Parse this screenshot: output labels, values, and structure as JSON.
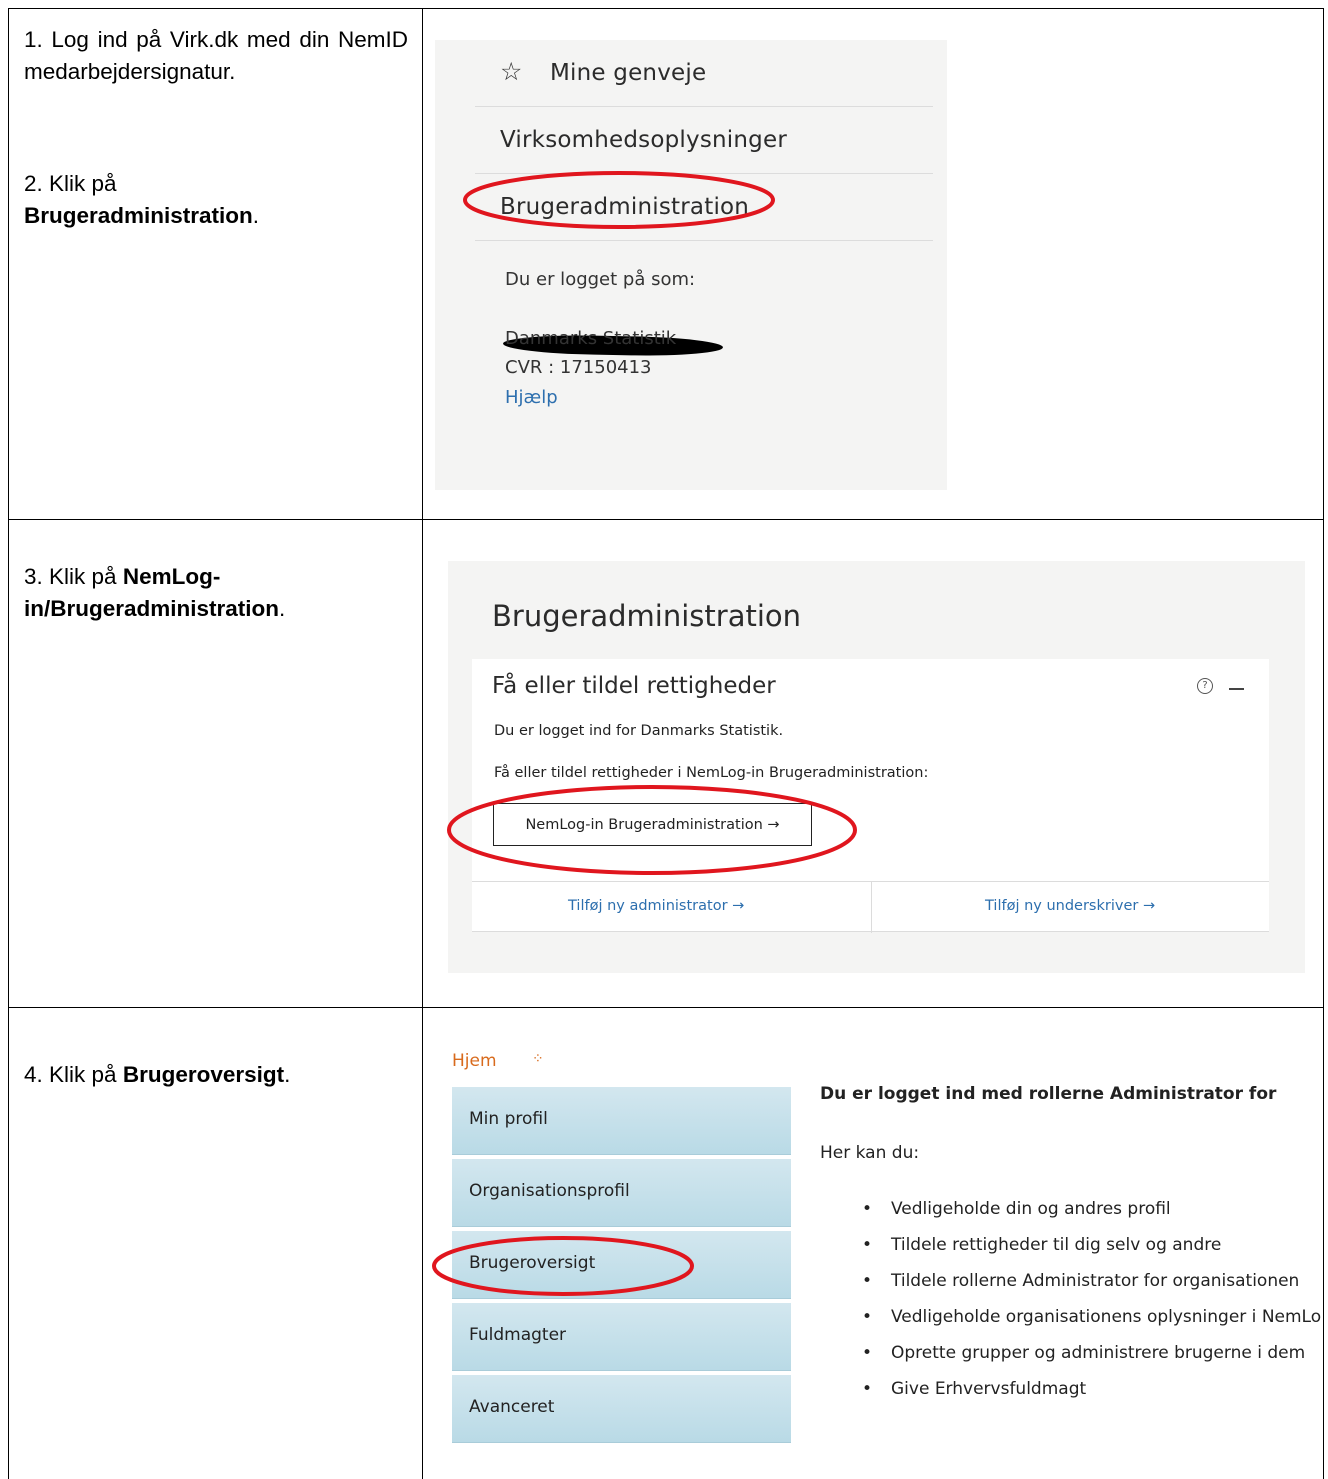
{
  "steps": {
    "s1": "1. Log ind på Virk.dk med din NemID medarbejdersignatur.",
    "s2_prefix": "2. Klik på",
    "s2_bold": "Brugeradministration",
    "s2_suffix": ".",
    "s3_prefix": "3. Klik på",
    "s3_bold_1": "NemLog-",
    "s3_bold_2": "in/Brugeradministration",
    "s3_suffix": ".",
    "s4_prefix": "4. Klik på",
    "s4_bold": "Brugeroversigt",
    "s4_suffix": "."
  },
  "panel1": {
    "menu": [
      {
        "label": "Mine genveje",
        "icon": "star-icon"
      },
      {
        "label": "Virksomhedsoplysninger"
      },
      {
        "label": "Brugeradministration"
      }
    ],
    "logged_in_label": "Du er logget på som:",
    "org": "Danmarks Statistik",
    "cvr": "CVR : 17150413",
    "help_link": "Hjælp"
  },
  "panel2": {
    "title": "Brugeradministration",
    "card_title": "Få eller tildel rettigheder",
    "text1": "Du er logget ind for Danmarks Statistik.",
    "text2": "Få eller tildel rettigheder i NemLog-in Brugeradministration:",
    "button": "NemLog-in Brugeradministration →",
    "link_left": "Tilføj ny administrator →",
    "link_right": "Tilføj ny underskriver →",
    "help_glyph": "?"
  },
  "panel3": {
    "breadcrumb": "Hjem",
    "nav": [
      "Min profil",
      "Organisationsprofil",
      "Brugeroversigt",
      "Fuldmagter",
      "Avanceret"
    ],
    "heading": "Du er logget ind med rollerne Administrator for",
    "sub": "Her kan du:",
    "bullets": [
      "Vedligeholde din og andres profil",
      "Tildele rettigheder til dig selv og andre",
      "Tildele rollerne Administrator for organisationen",
      "Vedligeholde organisationens oplysninger i NemLog-in",
      "Oprette grupper og administrere brugerne i dem",
      "Give Erhvervsfuldmagt"
    ]
  },
  "colors": {
    "highlight": "#e0161e",
    "link": "#2d6fae",
    "breadcrumb": "#d86a1c",
    "nav_bg": "#c6e0ea"
  }
}
